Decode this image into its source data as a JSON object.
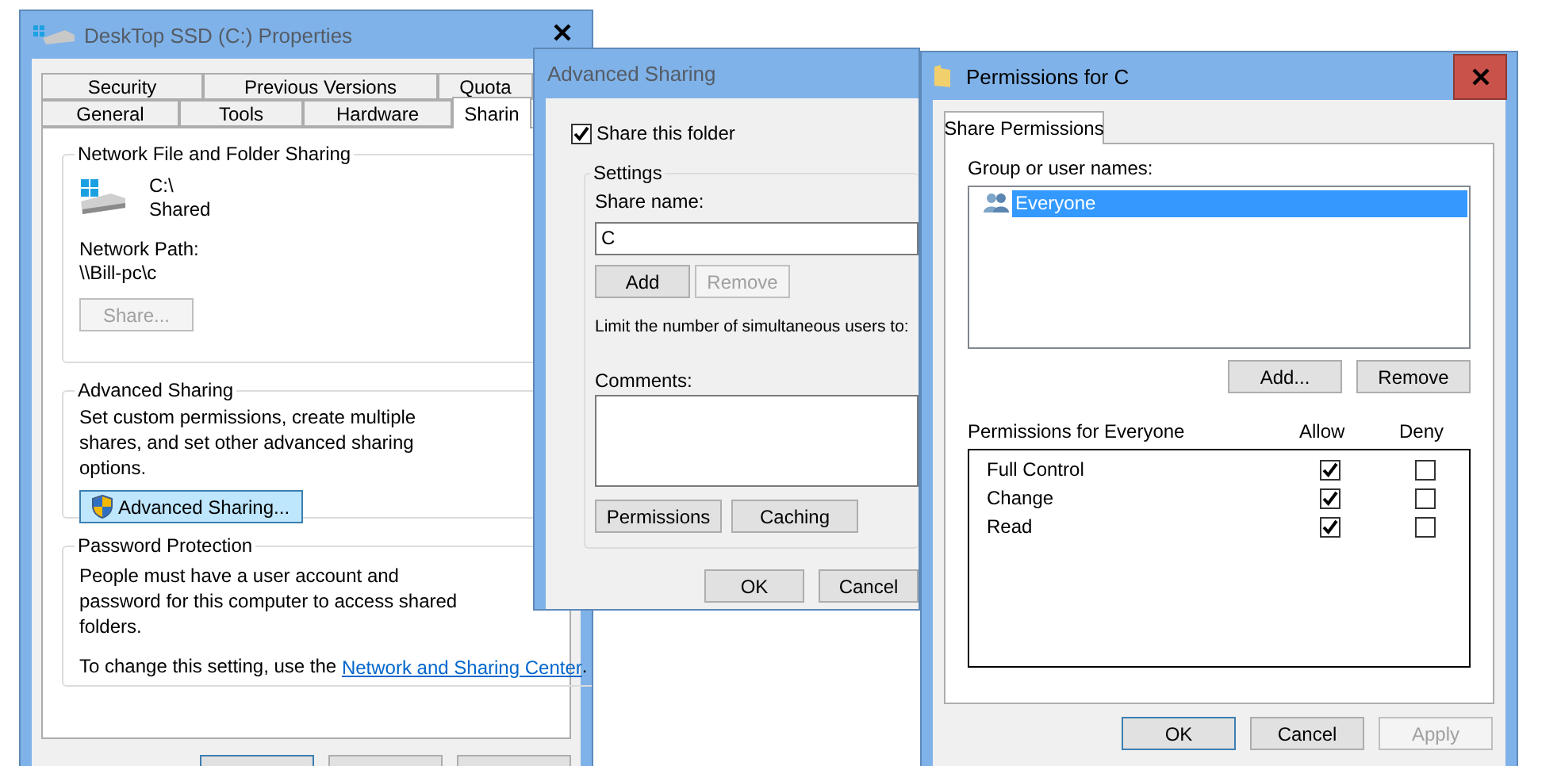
{
  "properties_window": {
    "title": "DeskTop SSD (C:) Properties",
    "tab_rows": [
      {
        "tabs": [
          {
            "label": "Security",
            "selected": false
          },
          {
            "label": "Previous Versions",
            "selected": false
          },
          {
            "label": "Quota",
            "selected": false
          }
        ]
      },
      {
        "tabs": [
          {
            "label": "General",
            "selected": false
          },
          {
            "label": "Tools",
            "selected": false
          },
          {
            "label": "Hardware",
            "selected": false
          },
          {
            "label": "Sharin",
            "selected": true
          }
        ]
      }
    ],
    "network_sharing": {
      "title": "Network File and Folder Sharing",
      "drive_name": "C:\\",
      "drive_status": "Shared",
      "path_label": "Network Path:",
      "path": "\\\\Bill-pc\\c",
      "share_button": {
        "label": "Share...",
        "disabled": true
      }
    },
    "advanced_sharing": {
      "title": "Advanced Sharing",
      "description": "Set custom permissions, create multiple shares, and set other advanced sharing options.",
      "button": {
        "label": "Advanced Sharing...",
        "disabled": false
      }
    },
    "password_protection": {
      "title": "Password Protection",
      "description": "People must have a user account and password for this computer to access shared folders.",
      "change_text": "To change this setting, use the ",
      "link": "Network and Sharing Center",
      "after_link": "."
    }
  },
  "advanced_sharing_window": {
    "title": "Advanced Sharing",
    "share_checkbox": {
      "label": "Share this folder",
      "checked": true
    },
    "settings": {
      "title": "Settings",
      "share_name_label": "Share name:",
      "share_name": "C",
      "name_buttons": [
        {
          "label": "Add",
          "disabled": false
        },
        {
          "label": "Remove",
          "disabled": true
        }
      ],
      "limit_label": "Limit the number of simultaneous users to:",
      "comments_label": "Comments:",
      "buttons": [
        {
          "label": "Permissions",
          "disabled": false
        },
        {
          "label": "Caching",
          "disabled": false
        }
      ]
    },
    "footer_buttons": [
      {
        "label": "OK",
        "disabled": false
      },
      {
        "label": "Cancel",
        "disabled": false
      }
    ]
  },
  "permissions_window": {
    "title": "Permissions for C",
    "tabs": [
      {
        "label": "Share Permissions",
        "selected": true
      }
    ],
    "group_label": "Group or user names:",
    "users": [
      {
        "name": "Everyone",
        "selected": true
      }
    ],
    "user_buttons": [
      {
        "label": "Add...",
        "disabled": false
      },
      {
        "label": "Remove",
        "disabled": false
      }
    ],
    "permissions_label": "Permissions for Everyone",
    "allow_label": "Allow",
    "deny_label": "Deny",
    "permissions": [
      {
        "name": "Full Control",
        "allow": true,
        "deny": false
      },
      {
        "name": "Change",
        "allow": true,
        "deny": false
      },
      {
        "name": "Read",
        "allow": true,
        "deny": false
      }
    ],
    "footer_buttons": [
      {
        "label": "OK",
        "default": true,
        "disabled": false
      },
      {
        "label": "Cancel",
        "default": false,
        "disabled": false
      },
      {
        "label": "Apply",
        "default": false,
        "disabled": true
      }
    ]
  }
}
